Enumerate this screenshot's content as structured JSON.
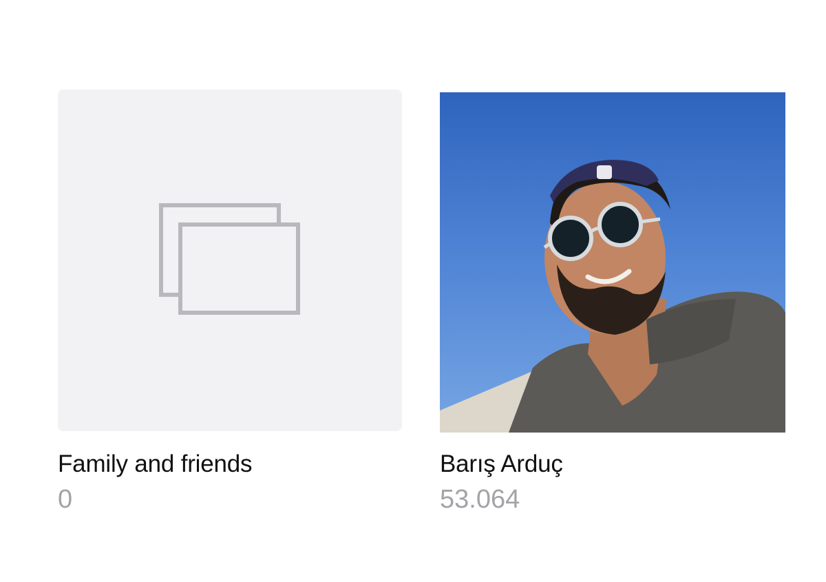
{
  "albums": [
    {
      "title": "Family and friends",
      "count": "0",
      "thumbnail": "empty-album-placeholder",
      "icon": "stacked-photos-icon"
    },
    {
      "title": "Barış Arduç",
      "count": "53.064",
      "thumbnail": "photo"
    }
  ],
  "colors": {
    "placeholder_bg": "#f2f2f4",
    "icon_stroke": "#b9b9bd",
    "title_text": "#111111",
    "count_text": "#a3a3a8",
    "sky": "#3f74cb"
  }
}
